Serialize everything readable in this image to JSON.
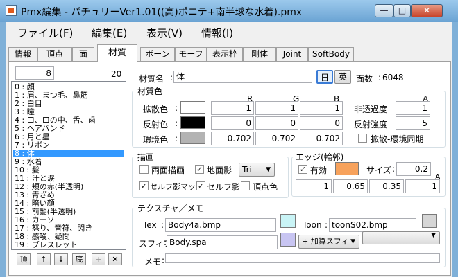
{
  "window": {
    "title": "Pmx編集 - パチュリーVer1.01((高)ポニテ+南半球な水着).pmx",
    "minimize": "—",
    "maximize": "□",
    "close": "✕"
  },
  "menu": [
    "ファイル(F)",
    "編集(E)",
    "表示(V)",
    "情報(I)"
  ],
  "tabs": [
    {
      "label": "情報"
    },
    {
      "label": "頂点"
    },
    {
      "label": "面"
    },
    {
      "label": "材質",
      "active": true
    },
    {
      "label": "ボーン"
    },
    {
      "label": "モーフ"
    },
    {
      "label": "表示枠"
    },
    {
      "label": "剛体"
    },
    {
      "label": "Joint"
    },
    {
      "label": "SoftBody"
    }
  ],
  "list": {
    "index_value": "8",
    "count": "20",
    "items": [
      "0 : 顔",
      "1 : 眉、まつ毛、鼻筋",
      "2 : 白目",
      "3 : 瞳",
      "4 : 口、口の中、舌、歯",
      "5 : ヘアバンド",
      "6 : 月と星",
      "7 : リボン",
      "8 : 体",
      "9 : 水着",
      "10 : 髪",
      "11 : 汗と涙",
      "12 : 頬の赤(半透明)",
      "13 : 青ざめ",
      "14 : 暗い顔",
      "15 : 前髪(半透明)",
      "16 : カーソ",
      "17 : 怒り、音符、閃き",
      "18 : 感嘆、疑問",
      "19 : ブレスレット"
    ],
    "selected_index": 8,
    "buttons": {
      "top": "頂",
      "up": "↑",
      "down": "↓",
      "bottom": "底",
      "add": "+",
      "delete": "✕"
    }
  },
  "material": {
    "name_label": "材質名",
    "name_value": "体",
    "lang_ja": "日",
    "lang_en": "英",
    "face_count_label": "面数",
    "face_count": "6048"
  },
  "color": {
    "group_title": "材質色",
    "r": "R",
    "g": "G",
    "b": "B",
    "a": "A",
    "diffuse_label": "拡散色",
    "diffuse": {
      "r": "1",
      "g": "1",
      "b": "1",
      "swatch": "#ffffff"
    },
    "specular_label": "反射色",
    "specular": {
      "r": "0",
      "g": "0",
      "b": "0",
      "swatch": "#000000"
    },
    "ambient_label": "環境色",
    "ambient": {
      "r": "0.702",
      "g": "0.702",
      "b": "0.702",
      "swatch": "#b3b3b3"
    },
    "opacity_label": "非透過度",
    "opacity": "1",
    "shininess_label": "反射強度",
    "shininess": "5",
    "sync_label": "拡散-環境同期"
  },
  "draw": {
    "group_title": "描画",
    "double_sided": "両面描画",
    "ground_shadow": "地面影",
    "prim_value": "Tri",
    "self_shadow_map": "セルフ影マップ",
    "self_shadow": "セルフ影",
    "vertex_color": "頂点色"
  },
  "edge": {
    "group_title": "エッジ(輪郭)",
    "enabled": "有効",
    "swatch": "#f7a25c",
    "size_label": "サイズ",
    "size": "0.2",
    "a_label": "A",
    "values": [
      "1",
      "0.65",
      "0.35",
      "1"
    ]
  },
  "texture": {
    "group_title": "テクスチャ／メモ",
    "tex_label": "Tex",
    "tex_value": "Body4a.bmp",
    "tex_swatch": "#c9f4f6",
    "toon_label": "Toon",
    "toon_value": "toonS02.bmp",
    "toon_swatch": "#d6d6d6",
    "sphere_label": "スフィア",
    "sphere_value": "Body.spa",
    "sphere_swatch": "#c8c5f2",
    "sphere_mode": "+ 加算スフィ",
    "memo_label": "メモ"
  }
}
